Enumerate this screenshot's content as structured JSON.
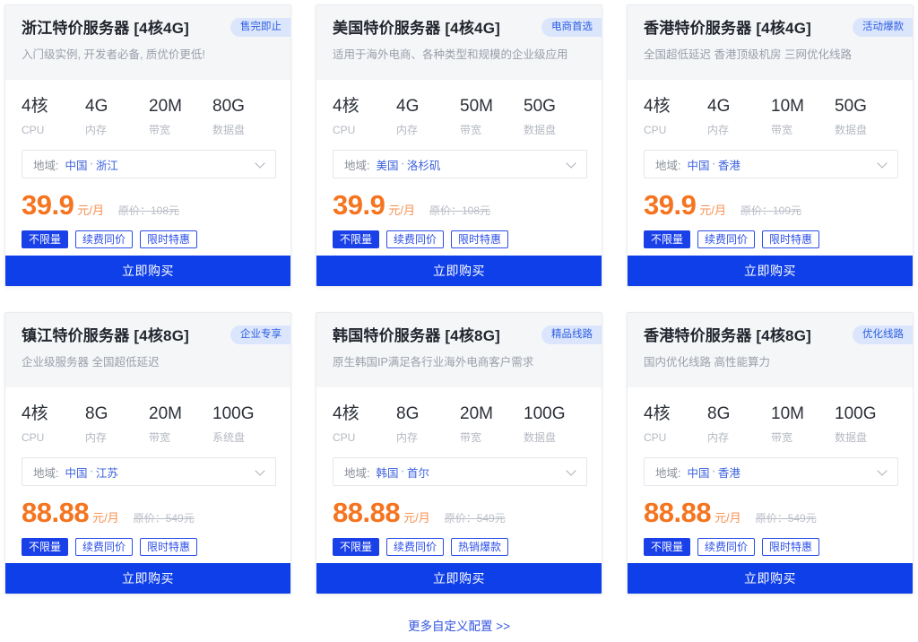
{
  "page": {
    "background": "#ffffff",
    "accent_blue": "#0f3fe8",
    "accent_orange": "#f5741f",
    "badge_bg": "#dbe6fd",
    "badge_text": "#2f5fe0"
  },
  "cards": [
    {
      "title": "浙江特价服务器 [4核4G]",
      "subtitle": "入门级实例, 开发者必备, 质优价更低!",
      "badge": "售完即止",
      "specs": [
        {
          "value": "4核",
          "label": "CPU"
        },
        {
          "value": "4G",
          "label": "内存"
        },
        {
          "value": "20M",
          "label": "带宽"
        },
        {
          "value": "80G",
          "label": "数据盘"
        }
      ],
      "region_label": "地域:",
      "region_country": "中国",
      "region_city": "浙江",
      "price": "39.9",
      "price_unit": "元/月",
      "old_price": "原价：108元",
      "tags": [
        "不限量",
        "续费同价",
        "限时特惠"
      ],
      "buy_label": "立即购买"
    },
    {
      "title": "美国特价服务器 [4核4G]",
      "subtitle": "适用于海外电商、各种类型和规模的企业级应用",
      "badge": "电商首选",
      "specs": [
        {
          "value": "4核",
          "label": "CPU"
        },
        {
          "value": "4G",
          "label": "内存"
        },
        {
          "value": "50M",
          "label": "带宽"
        },
        {
          "value": "50G",
          "label": "数据盘"
        }
      ],
      "region_label": "地域:",
      "region_country": "美国",
      "region_city": "洛杉矶",
      "price": "39.9",
      "price_unit": "元/月",
      "old_price": "原价：108元",
      "tags": [
        "不限量",
        "续费同价",
        "限时特惠"
      ],
      "buy_label": "立即购买"
    },
    {
      "title": "香港特价服务器 [4核4G]",
      "subtitle": "全国超低延迟 香港顶级机房 三网优化线路",
      "badge": "活动爆款",
      "specs": [
        {
          "value": "4核",
          "label": "CPU"
        },
        {
          "value": "4G",
          "label": "内存"
        },
        {
          "value": "10M",
          "label": "带宽"
        },
        {
          "value": "50G",
          "label": "数据盘"
        }
      ],
      "region_label": "地域:",
      "region_country": "中国",
      "region_city": "香港",
      "price": "39.9",
      "price_unit": "元/月",
      "old_price": "原价：109元",
      "tags": [
        "不限量",
        "续费同价",
        "限时特惠"
      ],
      "buy_label": "立即购买"
    },
    {
      "title": "镇江特价服务器 [4核8G]",
      "subtitle": "企业级服务器 全国超低延迟",
      "badge": "企业专享",
      "specs": [
        {
          "value": "4核",
          "label": "CPU"
        },
        {
          "value": "8G",
          "label": "内存"
        },
        {
          "value": "20M",
          "label": "带宽"
        },
        {
          "value": "100G",
          "label": "系统盘"
        }
      ],
      "region_label": "地域:",
      "region_country": "中国",
      "region_city": "江苏",
      "price": "88.88",
      "price_unit": "元/月",
      "old_price": "原价：549元",
      "tags": [
        "不限量",
        "续费同价",
        "限时特惠"
      ],
      "buy_label": "立即购买"
    },
    {
      "title": "韩国特价服务器 [4核8G]",
      "subtitle": "原生韩国IP满足各行业海外电商客户需求",
      "badge": "精品线路",
      "specs": [
        {
          "value": "4核",
          "label": "CPU"
        },
        {
          "value": "8G",
          "label": "内存"
        },
        {
          "value": "20M",
          "label": "带宽"
        },
        {
          "value": "100G",
          "label": "数据盘"
        }
      ],
      "region_label": "地域:",
      "region_country": "韩国",
      "region_city": "首尔",
      "price": "88.88",
      "price_unit": "元/月",
      "old_price": "原价：549元",
      "tags": [
        "不限量",
        "续费同价",
        "热销爆款"
      ],
      "buy_label": "立即购买"
    },
    {
      "title": "香港特价服务器 [4核8G]",
      "subtitle": "国内优化线路 高性能算力",
      "badge": "优化线路",
      "specs": [
        {
          "value": "4核",
          "label": "CPU"
        },
        {
          "value": "8G",
          "label": "内存"
        },
        {
          "value": "10M",
          "label": "带宽"
        },
        {
          "value": "100G",
          "label": "数据盘"
        }
      ],
      "region_label": "地域:",
      "region_country": "中国",
      "region_city": "香港",
      "price": "88.88",
      "price_unit": "元/月",
      "old_price": "原价：549元",
      "tags": [
        "不限量",
        "续费同价",
        "限时特惠"
      ],
      "buy_label": "立即购买"
    }
  ],
  "footer": {
    "more_link": "更多自定义配置 >>"
  }
}
